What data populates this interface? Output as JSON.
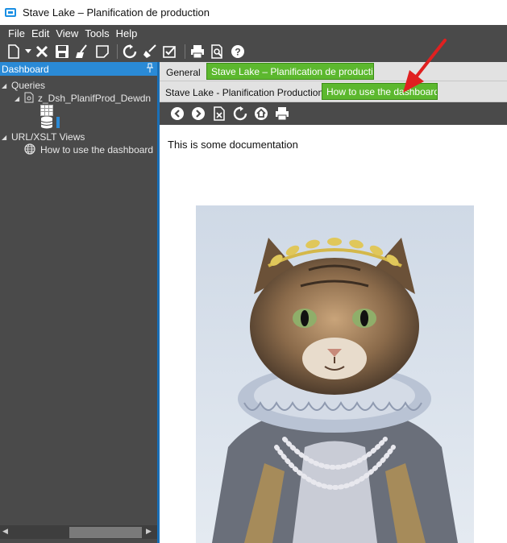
{
  "window": {
    "title": "Stave Lake – Planification de production"
  },
  "menu": [
    "File",
    "Edit",
    "View",
    "Tools",
    "Help"
  ],
  "toolbar": {
    "buttons": [
      "new-icon",
      "delete-icon",
      "save-icon",
      "clean-icon",
      "note-icon",
      "refresh-icon",
      "broom-icon",
      "checklist-icon",
      "print-icon",
      "preview-icon",
      "help-icon"
    ]
  },
  "left_panel": {
    "header": "Dashboard",
    "pin": "ꟸ",
    "tree": {
      "queries_label": "Queries",
      "query_name": "z_Dsh_PlanifProd_Dewdn",
      "views_label": "URL/XSLT Views",
      "view_name": "How to use the dashboard"
    }
  },
  "tabs_row1": {
    "general": "General",
    "stave": "Stave Lake – Planification de producti…"
  },
  "tabs_row2": {
    "stave_prod": "Stave Lake - Planification Production",
    "how_to": "How to use the dashboard"
  },
  "content": {
    "doc_text": "This is some documentation"
  },
  "colors": {
    "dark_bg": "#4a4a4a",
    "accent_blue": "#2a8ad6",
    "tab_green": "#5cb82e",
    "arrow_red": "#e02020"
  }
}
